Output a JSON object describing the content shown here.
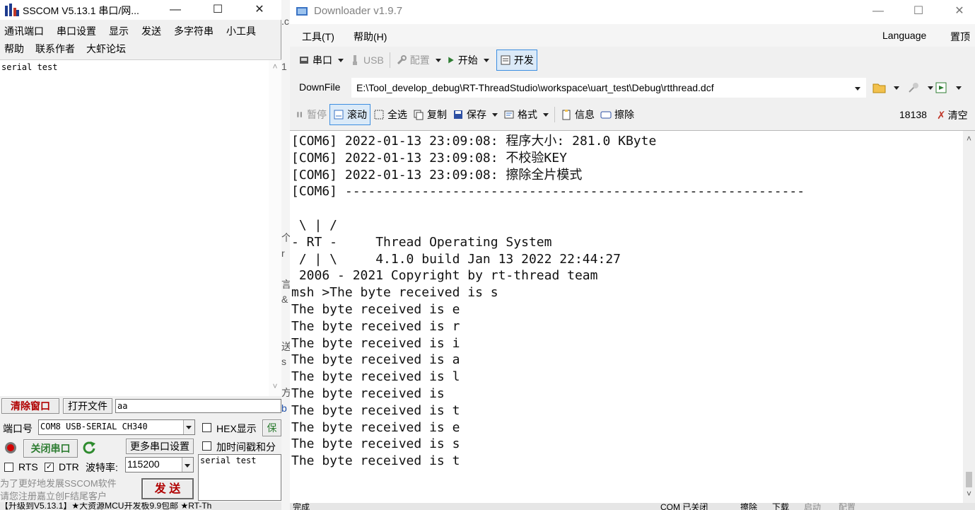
{
  "sscom": {
    "title": "SSCOM V5.13.1 串口/网...",
    "menu_row1": [
      "通讯端口",
      "串口设置",
      "显示",
      "发送",
      "多字符串",
      "小工具"
    ],
    "menu_row2": [
      "帮助",
      "联系作者",
      "大虾论坛"
    ],
    "receive_text": "serial test",
    "clear_button": "清除窗口",
    "open_file_button": "打开文件",
    "file_input_value": "aa",
    "port_label": "端口号",
    "port_value": "COM8 USB-SERIAL CH340",
    "hex_display_label": "HEX显示",
    "save_button": "保",
    "close_port_button": "关闭串口",
    "more_settings_button": "更多串口设置",
    "timestamp_label": "加时间戳和分",
    "rts_label": "RTS",
    "dtr_label": "DTR",
    "baud_label": "波特率:",
    "baud_value": "115200",
    "send_text": "serial test",
    "ad_line1": "为了更好地发展SSCOM软件",
    "ad_line2": "请您注册嘉立创F结尾客户",
    "send_button": "发 送",
    "status_text": "【升级到V5.13.1】★大资源MCU开发板9.9包邮 ★RT-Th"
  },
  "sliver_chars": [
    ".c",
    "1",
    "个",
    "r",
    "言",
    "&",
    "送",
    "s",
    "方",
    "b"
  ],
  "downloader": {
    "title": "Downloader v1.9.7",
    "menu": [
      "工具(T)",
      "帮助(H)"
    ],
    "menu_right": [
      "Language",
      "置顶"
    ],
    "toolbar1": {
      "serial": "串口",
      "usb": "USB",
      "config": "配置",
      "start": "开始",
      "develop": "开发"
    },
    "toolbar2": {
      "label": "DownFile",
      "path": "E:\\Tool_develop_debug\\RT-ThreadStudio\\workspace\\uart_test\\Debug\\rtthread.dcf"
    },
    "toolbar3": {
      "pause": "暂停",
      "scroll": "滚动",
      "select_all": "全选",
      "copy": "复制",
      "save": "保存",
      "format": "格式",
      "info": "信息",
      "erase": "擦除",
      "count": "18138",
      "clear": "清空"
    },
    "log_lines": [
      "[COM6] 2022-01-13 23:09:08: 程序大小: 281.0 KByte",
      "[COM6] 2022-01-13 23:09:08: 不校验KEY",
      "[COM6] 2022-01-13 23:09:08: 擦除全片模式",
      "[COM6] ------------------------------------------------------------",
      "",
      " \\ | /",
      "- RT -     Thread Operating System",
      " / | \\     4.1.0 build Jan 13 2022 22:44:27",
      " 2006 - 2021 Copyright by rt-thread team",
      "msh >The byte received is s",
      "The byte received is e",
      "The byte received is r",
      "The byte received is i",
      "The byte received is a",
      "The byte received is l",
      "The byte received is  ",
      "The byte received is t",
      "The byte received is e",
      "The byte received is s",
      "The byte received is t"
    ],
    "status_items": [
      "完成",
      "COM 已关闭",
      "擦除",
      "下载",
      "启动",
      "配置"
    ]
  }
}
